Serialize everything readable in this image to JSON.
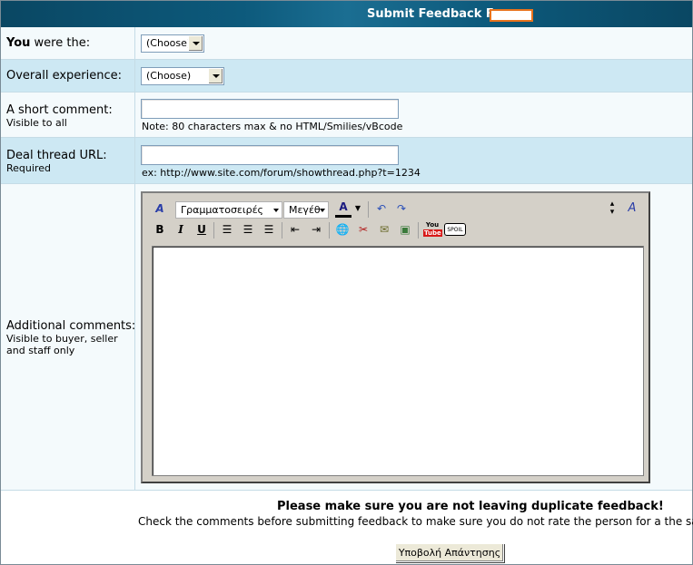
{
  "header": {
    "title": "Submit Feedback For"
  },
  "rows": {
    "role": {
      "label_bold": "You",
      "label_rest": " were the:",
      "select_value": "(Choose)"
    },
    "experience": {
      "label": "Overall experience:",
      "select_value": "(Choose)"
    },
    "short_comment": {
      "label": "A short comment:",
      "sub": "Visible to all",
      "value": "",
      "note": "Note: 80 characters max & no HTML/Smilies/vBcode"
    },
    "deal_url": {
      "label": "Deal thread URL:",
      "sub": "Required",
      "value": "",
      "note": "ex: http://www.site.com/forum/showthread.php?t=1234"
    },
    "additional": {
      "label": "Additional comments:",
      "sub_line1": "Visible to buyer, seller",
      "sub_line2": "and staff only"
    }
  },
  "editor": {
    "font_select": "Γραμματοσειρές",
    "size_select": "Μεγέθ",
    "icons": [
      "remove-format-icon",
      "font-color-icon",
      "undo-icon",
      "redo-icon",
      "resize-icon",
      "switch-mode-icon",
      "bold-icon",
      "italic-icon",
      "underline-icon",
      "align-left-icon",
      "align-center-icon",
      "align-right-icon",
      "outdent-icon",
      "indent-icon",
      "insert-link-icon",
      "unlink-icon",
      "insert-email-icon",
      "insert-image-icon",
      "youtube-icon",
      "spoiler-icon"
    ],
    "bold_glyph": "B",
    "italic_glyph": "I",
    "underline_glyph": "U",
    "youtube_label": "You",
    "spoiler_label": "SPOIL"
  },
  "footer": {
    "warning": "Please make sure you are not leaving duplicate feedback!",
    "info": "Check the comments before submitting feedback to make sure you do not rate the person for a the same i",
    "submit_label": "Υποβολή Απάντησης"
  }
}
